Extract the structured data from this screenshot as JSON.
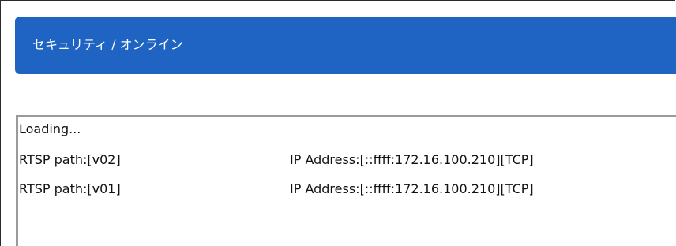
{
  "header": {
    "title": "セキュリティ / オンライン"
  },
  "log": {
    "loading": "Loading...",
    "rows": [
      {
        "path": "RTSP path:[v02]",
        "address": "IP Address:[::ffff:172.16.100.210][TCP]"
      },
      {
        "path": "RTSP path:[v01]",
        "address": "IP Address:[::ffff:172.16.100.210][TCP]"
      }
    ]
  },
  "colors": {
    "header_bg": "#1f64c2",
    "header_text": "#ffffff",
    "text": "#111111",
    "panel_border": "#9a9a9a"
  }
}
